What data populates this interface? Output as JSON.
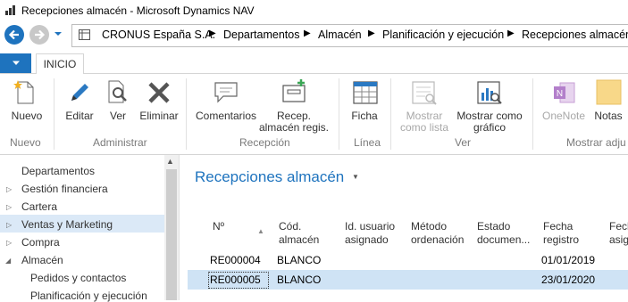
{
  "window": {
    "title": "Recepciones almacén - Microsoft Dynamics NAV"
  },
  "breadcrumb": [
    "CRONUS España S.A.",
    "Departamentos",
    "Almacén",
    "Planificación y ejecución",
    "Recepciones almacén"
  ],
  "ribbon": {
    "tab": "INICIO",
    "buttons": {
      "nuevo": "Nuevo",
      "editar": "Editar",
      "ver": "Ver",
      "eliminar": "Eliminar",
      "comentarios": "Comentarios",
      "recep1": "Recep.",
      "recep2": "almacén regis.",
      "ficha": "Ficha",
      "mostrar_lista1": "Mostrar",
      "mostrar_lista2": "como lista",
      "mostrar_grafico1": "Mostrar como",
      "mostrar_grafico2": "gráfico",
      "onenote": "OneNote",
      "notas": "Notas"
    },
    "groups": {
      "nuevo": "Nuevo",
      "administrar": "Administrar",
      "recepcion": "Recepción",
      "linea": "Línea",
      "ver": "Ver",
      "mostrar_adjuntos": "Mostrar adju"
    }
  },
  "nav": {
    "items": [
      "Departamentos",
      "Gestión financiera",
      "Cartera",
      "Ventas y Marketing",
      "Compra",
      "Almacén",
      "Pedidos y contactos",
      "Planificación y ejecución"
    ]
  },
  "page": {
    "title": "Recepciones almacén",
    "columns": [
      [
        "Nº",
        ""
      ],
      [
        "Cód.",
        "almacén"
      ],
      [
        "Id. usuario",
        "asignado"
      ],
      [
        "Método",
        "ordenación"
      ],
      [
        "Estado",
        "documen..."
      ],
      [
        "Fecha",
        "registro"
      ],
      [
        "Fech",
        "asig"
      ]
    ],
    "rows": [
      {
        "no": "RE000004",
        "almacen": "BLANCO",
        "fecha": "01/01/2019"
      },
      {
        "no": "RE000005",
        "almacen": "BLANCO",
        "fecha": "23/01/2020"
      }
    ]
  },
  "colors": {
    "accent": "#1e73be",
    "selected_row": "#cfe3f5"
  }
}
